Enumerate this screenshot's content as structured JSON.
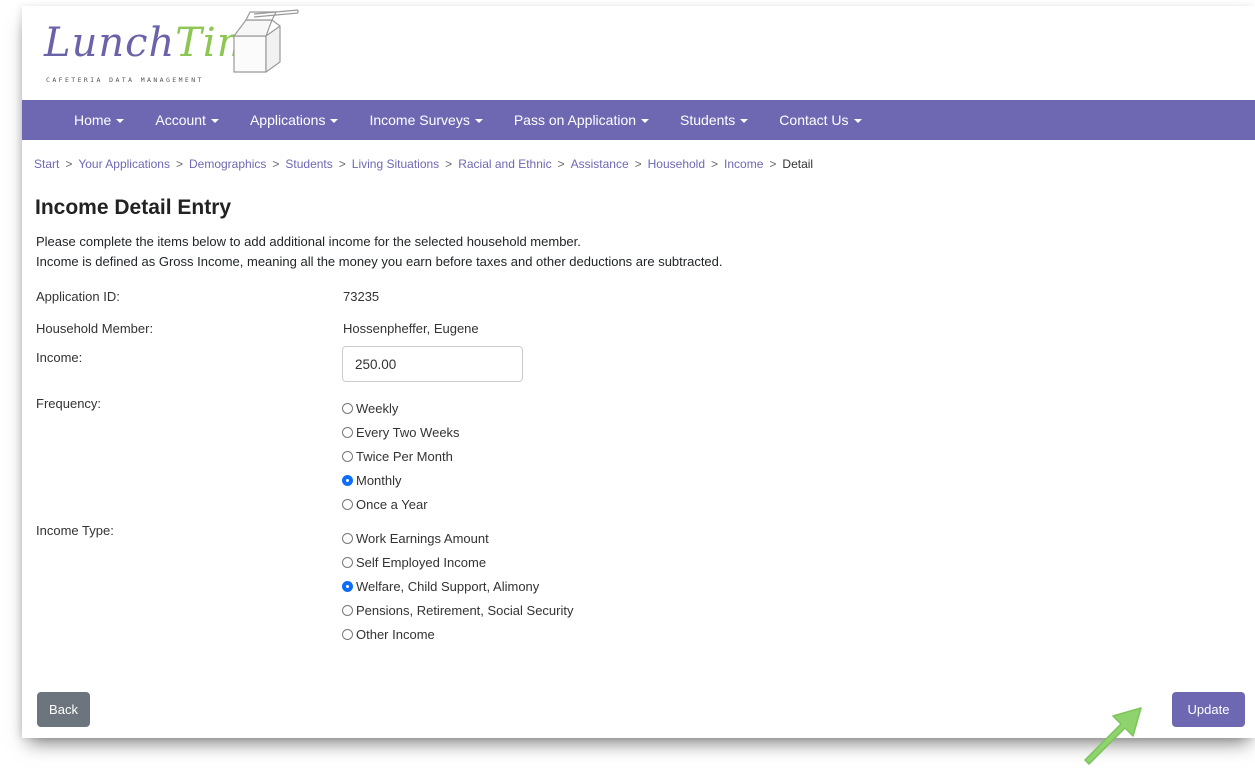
{
  "logo": {
    "brand_part1": "Lunch",
    "brand_part2": "Time",
    "tagline": "CAFETERIA DATA MANAGEMENT",
    "icon": "milk-carton-icon",
    "colors": {
      "lunch": "#6b63a9",
      "time": "#8ec654"
    }
  },
  "nav": {
    "color": "#6e68b3",
    "items": [
      {
        "label": "Home"
      },
      {
        "label": "Account"
      },
      {
        "label": "Applications"
      },
      {
        "label": "Income Surveys"
      },
      {
        "label": "Pass on Application"
      },
      {
        "label": "Students"
      },
      {
        "label": "Contact Us"
      }
    ]
  },
  "breadcrumb": {
    "separator": ">",
    "links": [
      "Start",
      "Your Applications",
      "Demographics",
      "Students",
      "Living Situations",
      "Racial and Ethnic",
      "Assistance",
      "Household",
      "Income"
    ],
    "current": "Detail"
  },
  "page": {
    "title": "Income Detail Entry",
    "intro_line1": "Please complete the items below to add additional income for the selected household member.",
    "intro_line2": "Income is defined as Gross Income, meaning all the money you earn before taxes and other deductions are subtracted."
  },
  "form": {
    "application_id_label": "Application ID:",
    "application_id_value": "73235",
    "household_member_label": "Household Member:",
    "household_member_value": "Hossenpheffer, Eugene",
    "income_label": "Income:",
    "income_value": "250.00",
    "frequency_label": "Frequency:",
    "frequency_options": [
      "Weekly",
      "Every Two Weeks",
      "Twice Per Month",
      "Monthly",
      "Once a Year"
    ],
    "frequency_selected": "Monthly",
    "income_type_label": "Income Type:",
    "income_type_options": [
      "Work Earnings Amount",
      "Self Employed Income",
      "Welfare, Child Support, Alimony",
      "Pensions, Retirement, Social Security",
      "Other Income"
    ],
    "income_type_selected": "Welfare, Child Support, Alimony"
  },
  "buttons": {
    "back_label": "Back",
    "update_label": "Update",
    "back_color": "#6c757d",
    "update_color": "#6e68b3"
  },
  "annotation": {
    "icon": "pointer-arrow-icon",
    "color": "#8fd36e"
  }
}
